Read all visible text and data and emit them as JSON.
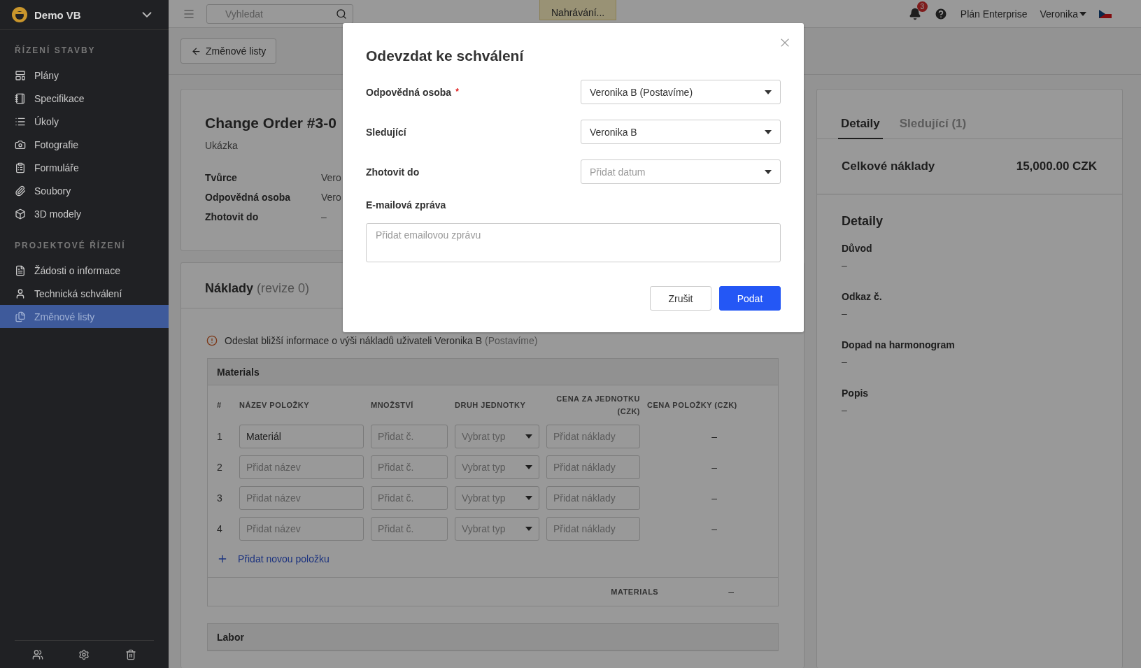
{
  "sidebar": {
    "project": "Demo VB",
    "sections": [
      {
        "title": "ŘÍZENÍ STAVBY",
        "items": [
          {
            "label": "Plány",
            "selected": false
          },
          {
            "label": "Specifikace",
            "selected": false
          },
          {
            "label": "Úkoly",
            "selected": false
          },
          {
            "label": "Fotografie",
            "selected": false
          },
          {
            "label": "Formuláře",
            "selected": false
          },
          {
            "label": "Soubory",
            "selected": false
          },
          {
            "label": "3D modely",
            "selected": false
          }
        ]
      },
      {
        "title": "PROJEKTOVÉ ŘÍZENÍ",
        "items": [
          {
            "label": "Žádosti o informace",
            "selected": false
          },
          {
            "label": "Technická schválení",
            "selected": false
          },
          {
            "label": "Změnové listy",
            "selected": true
          }
        ]
      }
    ]
  },
  "topbar": {
    "search_placeholder": "Vyhledat",
    "status": "Nahrávání...",
    "notification_count": "3",
    "plan": "Plán Enterprise",
    "user": "Veronika"
  },
  "back_button": "Změnové listy",
  "change_order": {
    "title": "Change Order #3-0",
    "subtitle": "Ukázka",
    "fields": [
      {
        "label": "Tvůrce",
        "value": "Vero"
      },
      {
        "label": "Odpovědná osoba",
        "value": "Vero"
      },
      {
        "label": "Zhotovit do",
        "value": "–"
      }
    ]
  },
  "costs": {
    "title": "Náklady",
    "revision": "(revize 0)",
    "notice": "Odeslat bližší informace o výši nákladů uživateli Veronika B",
    "notice_muted": "(Postavíme)",
    "materials": {
      "title": "Materials",
      "columns": [
        "#",
        "NÁZEV POLOŽKY",
        "MNOŽSTVÍ",
        "DRUH JEDNOTKY",
        "CENA ZA JEDNOTKU (CZK)",
        "CENA POLOŽKY (CZK)"
      ],
      "rows": [
        {
          "number": "1",
          "name": "Materiál",
          "quantity_placeholder": "Přidat č.",
          "unit_placeholder": "Vybrat typ",
          "cost_placeholder": "Přidat náklady",
          "total": "–"
        },
        {
          "number": "2",
          "name_placeholder": "Přidat název",
          "quantity_placeholder": "Přidat č.",
          "unit_placeholder": "Vybrat typ",
          "cost_placeholder": "Přidat náklady",
          "total": "–"
        },
        {
          "number": "3",
          "name_placeholder": "Přidat název",
          "quantity_placeholder": "Přidat č.",
          "unit_placeholder": "Vybrat typ",
          "cost_placeholder": "Přidat náklady",
          "total": "–"
        },
        {
          "number": "4",
          "name_placeholder": "Přidat název",
          "quantity_placeholder": "Přidat č.",
          "unit_placeholder": "Vybrat typ",
          "cost_placeholder": "Přidat náklady",
          "total": "–"
        }
      ],
      "add_item": "Přidat novou položku",
      "subtotal_label": "MATERIALS",
      "subtotal": "–"
    },
    "labor": {
      "title": "Labor"
    }
  },
  "side_panel": {
    "tabs": [
      {
        "label": "Detaily",
        "selected": true
      },
      {
        "label": "Sledující (1)",
        "selected": false
      }
    ],
    "total_label": "Celkové náklady",
    "total_value": "15,000.00 CZK",
    "details_title": "Detaily",
    "fields": [
      {
        "label": "Důvod",
        "value": "–"
      },
      {
        "label": "Odkaz č.",
        "value": "–"
      },
      {
        "label": "Dopad na harmonogram",
        "value": "–"
      },
      {
        "label": "Popis",
        "value": "–"
      }
    ]
  },
  "modal": {
    "title": "Odevzdat ke schválení",
    "fields": [
      {
        "kind": "select",
        "label": "Odpovědná osoba",
        "required_mark": "*",
        "value": "Veronika B (Postavíme)"
      },
      {
        "kind": "select",
        "label": "Sledující",
        "value": "Veronika B"
      },
      {
        "kind": "select",
        "label": "Zhotovit do",
        "placeholder": "Přidat datum"
      },
      {
        "kind": "textarea",
        "label": "E-mailová zpráva",
        "placeholder": "Přidat emailovou zprávu"
      }
    ],
    "buttons": [
      {
        "label": "Zrušit",
        "kind": "secondary"
      },
      {
        "label": "Podat",
        "kind": "primary"
      }
    ]
  }
}
